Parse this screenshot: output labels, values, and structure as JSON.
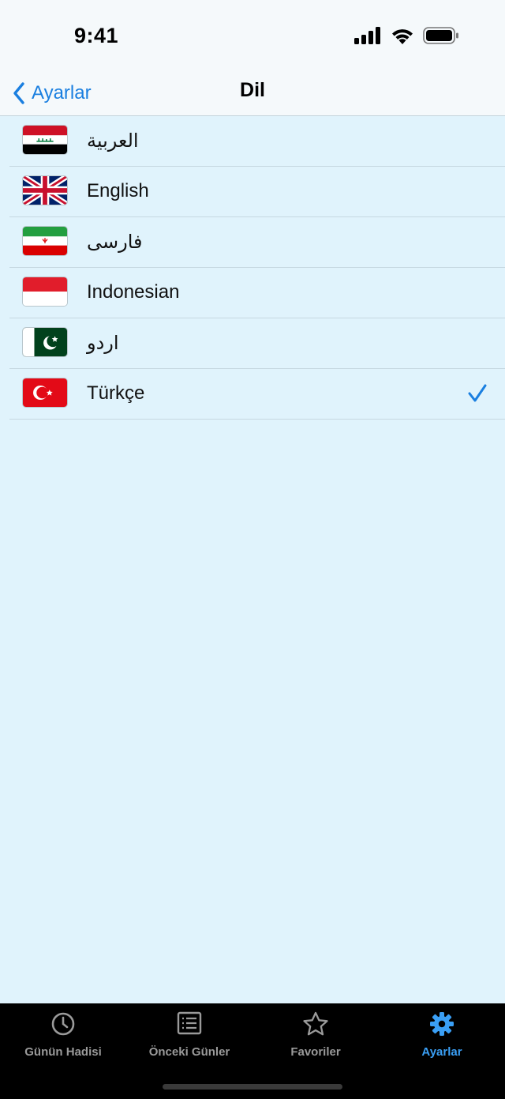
{
  "status_bar": {
    "time": "9:41",
    "icons": [
      "cellular-signal-icon",
      "wifi-icon",
      "battery-icon"
    ]
  },
  "nav": {
    "back_label": "Ayarlar",
    "title": "Dil"
  },
  "languages": [
    {
      "label": "العربية",
      "flag": "iraq-flag-icon",
      "selected": false
    },
    {
      "label": "English",
      "flag": "uk-flag-icon",
      "selected": false
    },
    {
      "label": "فارسی",
      "flag": "iran-flag-icon",
      "selected": false
    },
    {
      "label": "Indonesian",
      "flag": "indonesia-flag-icon",
      "selected": false
    },
    {
      "label": "اردو",
      "flag": "pakistan-flag-icon",
      "selected": false
    },
    {
      "label": "Türkçe",
      "flag": "turkey-flag-icon",
      "selected": true
    }
  ],
  "tabs": [
    {
      "label": "Günün Hadisi",
      "icon": "clock-icon",
      "active": false
    },
    {
      "label": "Önceki Günler",
      "icon": "list-icon",
      "active": false
    },
    {
      "label": "Favoriler",
      "icon": "star-icon",
      "active": false
    },
    {
      "label": "Ayarlar",
      "icon": "gear-icon",
      "active": true
    }
  ],
  "colors": {
    "accent": "#1a7fe0",
    "tab_active": "#3a9ff5",
    "background": "#e0f3fc",
    "tab_bar": "#000000"
  }
}
